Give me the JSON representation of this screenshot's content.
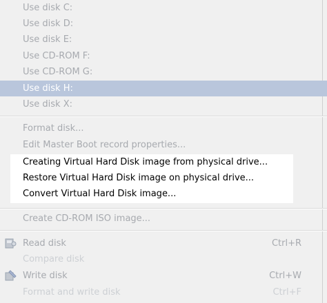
{
  "menu": {
    "items": [
      {
        "label": "Use disk C:"
      },
      {
        "label": "Use disk D:"
      },
      {
        "label": "Use disk E:"
      },
      {
        "label": "Use CD-ROM F:"
      },
      {
        "label": "Use CD-ROM G:"
      },
      {
        "label": "Use disk H:"
      },
      {
        "label": "Use disk X:"
      },
      {
        "label": "Format disk..."
      },
      {
        "label": "Edit Master Boot record properties..."
      },
      {
        "label": "Creating Virtual Hard Disk image from physical drive..."
      },
      {
        "label": "Restore Virtual Hard Disk image on physical drive..."
      },
      {
        "label": "Convert Virtual Hard Disk image..."
      },
      {
        "label": "Create CD-ROM ISO image..."
      },
      {
        "label": "Read disk",
        "shortcut": "Ctrl+R",
        "icon": "read-disk-icon"
      },
      {
        "label": "Compare disk"
      },
      {
        "label": "Write disk",
        "shortcut": "Ctrl+W",
        "icon": "write-disk-icon"
      },
      {
        "label": "Format and write disk",
        "shortcut": "Ctrl+F"
      }
    ],
    "selected": "Use disk H:",
    "colors": {
      "background": "#f0f0f0",
      "selection": "#b9c6dc",
      "disabled_text": "#a7aaaf",
      "enabled_text": "#000000"
    }
  }
}
